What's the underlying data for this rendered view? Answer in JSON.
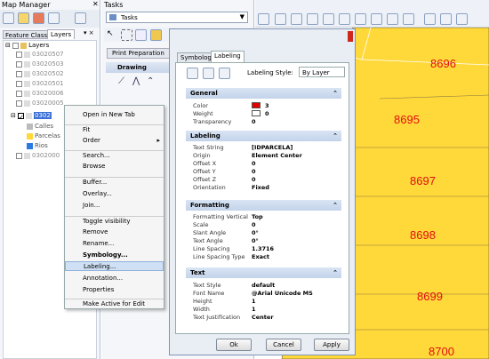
{
  "map_manager": {
    "title": "Map Manager",
    "tabs": [
      "Feature Classes",
      "Layers"
    ],
    "tree": {
      "root": "Layers",
      "items": [
        "03020507",
        "03020503",
        "03020502",
        "03020501",
        "03020006",
        "03020005",
        "0302"
      ],
      "sub_items": [
        "Calles",
        "Parcelas",
        "Rios"
      ],
      "last_item": "0302000"
    }
  },
  "tasks": {
    "title": "Tasks",
    "dropdown_value": "Tasks",
    "print_prep": "Print Preparation",
    "drawing": "Drawing"
  },
  "context_menu": {
    "items": [
      {
        "label": "Open in New Tab"
      },
      {
        "label": "Fit"
      },
      {
        "label": "Order",
        "submenu": true
      },
      {
        "label": "Search..."
      },
      {
        "label": "Browse"
      },
      {
        "label": "Buffer..."
      },
      {
        "label": "Overlay..."
      },
      {
        "label": "Join..."
      },
      {
        "label": "Toggle visibility"
      },
      {
        "label": "Remove"
      },
      {
        "label": "Rename..."
      },
      {
        "label": "Symbology...",
        "bold": true
      },
      {
        "label": "Labeling...",
        "highlighted": true
      },
      {
        "label": "Annotation..."
      },
      {
        "label": "Properties"
      },
      {
        "label": "Make Active for Edit"
      }
    ]
  },
  "dialog": {
    "tabs": [
      "Symbology",
      "Labeling"
    ],
    "active_tab": "Labeling",
    "style_label": "Labeling Style:",
    "style_value": "By Layer",
    "sections": [
      {
        "title": "General",
        "rows": [
          {
            "label": "Color",
            "value": "3",
            "swatch": "#e00000"
          },
          {
            "label": "Weight",
            "value": "0",
            "swatch": "#ffffff"
          },
          {
            "label": "Transparency",
            "value": "0"
          }
        ]
      },
      {
        "title": "Labeling",
        "rows": [
          {
            "label": "Text String",
            "value": "[IDPARCELA]"
          },
          {
            "label": "Origin",
            "value": "Element Center"
          },
          {
            "label": "Offset X",
            "value": "0"
          },
          {
            "label": "Offset Y",
            "value": "0"
          },
          {
            "label": "Offset Z",
            "value": "0"
          },
          {
            "label": "Orientation",
            "value": "Fixed"
          }
        ]
      },
      {
        "title": "Formatting",
        "rows": [
          {
            "label": "Formatting Vertical",
            "value": "Top"
          },
          {
            "label": "Scale",
            "value": "0"
          },
          {
            "label": "Slant Angle",
            "value": "0°"
          },
          {
            "label": "Text Angle",
            "value": "0°"
          },
          {
            "label": "Line Spacing",
            "value": "1.3716"
          },
          {
            "label": "Line Spacing Type",
            "value": "Exact"
          }
        ]
      },
      {
        "title": "Text",
        "rows": [
          {
            "label": "Text Style",
            "value": "default"
          },
          {
            "label": "Font Name",
            "value": "@Arial Unicode MS"
          },
          {
            "label": "Height",
            "value": "1"
          },
          {
            "label": "Width",
            "value": "1"
          },
          {
            "label": "Text Justification",
            "value": "Center"
          }
        ]
      }
    ],
    "buttons": [
      "Ok",
      "Cancel",
      "Apply"
    ]
  },
  "map": {
    "parcels": [
      "8696",
      "8695",
      "8697",
      "8698",
      "8699",
      "8700"
    ],
    "fill": "#ffd83a",
    "label_color": "#e01010"
  }
}
